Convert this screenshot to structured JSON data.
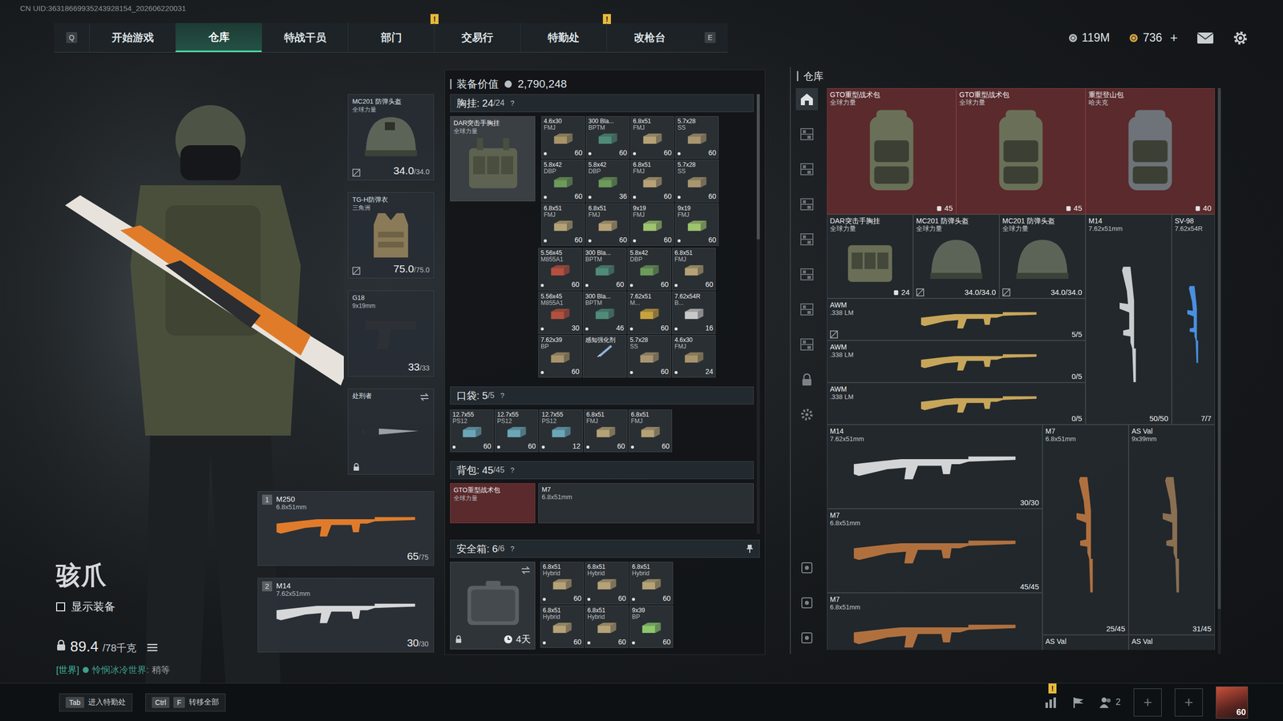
{
  "uid": "CN UID:36318669935243928154_202606220031",
  "nav": {
    "left_key": "Q",
    "right_key": "E",
    "alert_glyph": "!",
    "tabs": [
      {
        "label": "开始游戏",
        "selected": false,
        "alert": false
      },
      {
        "label": "仓库",
        "selected": true,
        "alert": false
      },
      {
        "label": "特战干员",
        "selected": false,
        "alert": false
      },
      {
        "label": "部门",
        "selected": false,
        "alert": true
      },
      {
        "label": "交易行",
        "selected": false,
        "alert": false
      },
      {
        "label": "特勤处",
        "selected": false,
        "alert": true
      },
      {
        "label": "改枪台",
        "selected": false,
        "alert": false
      }
    ]
  },
  "currency": [
    {
      "value": "119M",
      "color": "#b9bec4"
    },
    {
      "value": "736",
      "color": "#d9a441",
      "action": "+"
    }
  ],
  "character": {
    "name": "骇爪",
    "show_gear": {
      "label": "显示装备",
      "checked": false
    },
    "weight": "89.4",
    "weight_max": "/78千克"
  },
  "chat": {
    "channel": "[世界]",
    "sender": "怜悯冰冷世界:",
    "message": "稍等"
  },
  "equipment": [
    {
      "kind": "helmet",
      "name": "MC201 防弹头盔",
      "sub": "全球力量",
      "reading": "34.0",
      "max": "/34.0",
      "mark": true,
      "locked": false
    },
    {
      "kind": "vest",
      "name": "TG-H防弹衣",
      "sub": "三角洲",
      "reading": "75.0",
      "max": "/75.0",
      "mark": true,
      "locked": false
    },
    {
      "kind": "pistol",
      "name": "G18",
      "sub": "9x19mm",
      "reading": "33",
      "max": "/33",
      "mark": false,
      "locked": false
    },
    {
      "kind": "melee",
      "name": "处刑者",
      "mark": false,
      "locked": true
    }
  ],
  "weapons": [
    {
      "slot": "1",
      "name": "M250",
      "caliber": "6.8x51mm",
      "ammo": "65",
      "max": "/75",
      "color": "#e07b2a"
    },
    {
      "slot": "2",
      "name": "M14",
      "caliber": "7.62x51mm",
      "ammo": "30",
      "max": "/30",
      "color": "#d5d7d9"
    }
  ],
  "loadout": {
    "value_label": "装备价值",
    "value": "2,790,248",
    "chest": {
      "label": "胸挂",
      "count": "24",
      "max": "/24",
      "help": "?",
      "rig": {
        "name": "DAR突击手胸挂",
        "sub": "全球力量"
      },
      "blocks": [
        [
          {
            "kind": "ammo",
            "name": "4.6x30",
            "sub": "FMJ",
            "count": "60",
            "color": "#a8946a"
          },
          {
            "kind": "ammo",
            "name": "300 Bla...",
            "sub": "BPTM",
            "count": "60",
            "color": "#4f8b78"
          },
          {
            "kind": "ammo",
            "name": "6.8x51",
            "sub": "FMJ",
            "count": "60",
            "color": "#b5a276"
          },
          {
            "kind": "ammo",
            "name": "5.7x28",
            "sub": "SS",
            "count": "60",
            "color": "#a89670"
          },
          {
            "kind": "ammo",
            "name": "5.8x42",
            "sub": "DBP",
            "count": "60",
            "color": "#6e9a5a"
          },
          {
            "kind": "ammo",
            "name": "5.8x42",
            "sub": "DBP",
            "count": "36",
            "color": "#6e9a5a"
          },
          {
            "kind": "ammo",
            "name": "6.8x51",
            "sub": "FMJ",
            "count": "60",
            "color": "#b5a276"
          },
          {
            "kind": "ammo",
            "name": "5.7x28",
            "sub": "SS",
            "count": "60",
            "color": "#a89670"
          },
          {
            "kind": "ammo",
            "name": "6.8x51",
            "sub": "FMJ",
            "count": "60",
            "color": "#b5a276"
          },
          {
            "kind": "ammo",
            "name": "6.8x51",
            "sub": "FMJ",
            "count": "60",
            "color": "#b5a276"
          },
          {
            "kind": "ammo",
            "name": "9x19",
            "sub": "FMJ",
            "count": "60",
            "color": "#9ec46e"
          },
          {
            "kind": "ammo",
            "name": "9x19",
            "sub": "FMJ",
            "count": "60",
            "color": "#9ec46e"
          }
        ],
        [
          {
            "kind": "ammo",
            "name": "5.56x45",
            "sub": "M855A1",
            "count": "60",
            "color": "#b4503e"
          },
          {
            "kind": "ammo",
            "name": "300 Bla...",
            "sub": "BPTM",
            "count": "60",
            "color": "#4f8b78"
          },
          {
            "kind": "ammo",
            "name": "5.8x42",
            "sub": "DBP",
            "count": "60",
            "color": "#6e9a5a"
          },
          {
            "kind": "ammo",
            "name": "6.8x51",
            "sub": "FMJ",
            "count": "60",
            "color": "#b5a276"
          },
          {
            "kind": "ammo",
            "name": "5.56x45",
            "sub": "M855A1",
            "count": "30",
            "color": "#b4503e"
          },
          {
            "kind": "ammo",
            "name": "300 Bla...",
            "sub": "BPTM",
            "count": "46",
            "color": "#4f8b78"
          },
          {
            "kind": "ammo",
            "name": "7.62x51",
            "sub": "M...",
            "count": "60",
            "color": "#c9a23e"
          },
          {
            "kind": "ammo",
            "name": "7.62x54R",
            "sub": "B...",
            "count": "16",
            "color": "#c9c9c9"
          },
          {
            "kind": "ammo",
            "name": "7.62x39",
            "sub": "BP",
            "count": "60",
            "color": "#a8946a"
          },
          {
            "kind": "item",
            "name": "感知强化剂",
            "color": "#8fb0d8"
          },
          {
            "kind": "ammo",
            "name": "5.7x28",
            "sub": "SS",
            "count": "60",
            "color": "#a89670"
          },
          {
            "kind": "ammo",
            "name": "4.6x30",
            "sub": "FMJ",
            "count": "24",
            "color": "#a8946a"
          }
        ]
      ]
    },
    "pockets": {
      "label": "口袋",
      "count": "5",
      "max": "/5",
      "help": "?",
      "items": [
        {
          "kind": "ammo",
          "name": "12.7x55",
          "sub": "PS12",
          "count": "60",
          "color": "#6aa6b8"
        },
        {
          "kind": "ammo",
          "name": "12.7x55",
          "sub": "PS12",
          "count": "60",
          "color": "#6aa6b8"
        },
        {
          "kind": "ammo",
          "name": "12.7x55",
          "sub": "PS12",
          "count": "12",
          "color": "#6aa6b8"
        },
        {
          "kind": "ammo",
          "name": "6.8x51",
          "sub": "FMJ",
          "count": "60",
          "color": "#b5a276"
        },
        {
          "kind": "ammo",
          "name": "6.8x51",
          "sub": "FMJ",
          "count": "60",
          "color": "#b5a276"
        }
      ]
    },
    "backpack": {
      "label": "背包",
      "count": "45",
      "max": "/45",
      "help": "?",
      "bag": {
        "name": "GTO重型战术包",
        "sub": "全球力量"
      },
      "items": [
        {
          "name": "M7",
          "sub": "6.8x51mm"
        }
      ]
    },
    "safe": {
      "label": "安全箱",
      "count": "6",
      "max": "/6",
      "help": "?",
      "timer": "4天",
      "items": [
        {
          "kind": "ammo",
          "name": "6.8x51",
          "sub": "Hybrid",
          "count": "60",
          "color": "#b5a276"
        },
        {
          "kind": "ammo",
          "name": "6.8x51",
          "sub": "Hybrid",
          "count": "60",
          "color": "#b5a276"
        },
        {
          "kind": "ammo",
          "name": "6.8x51",
          "sub": "Hybrid",
          "count": "60",
          "color": "#b5a276"
        },
        {
          "kind": "ammo",
          "name": "6.8x51",
          "sub": "Hybrid",
          "count": "60",
          "color": "#b5a276"
        },
        {
          "kind": "ammo",
          "name": "6.8x51",
          "sub": "Hybrid",
          "count": "60",
          "color": "#b5a276"
        },
        {
          "kind": "ammo",
          "name": "9x39",
          "sub": "BP",
          "count": "60",
          "color": "#8cc86a"
        }
      ]
    }
  },
  "warehouse": {
    "title": "仓库",
    "sidebar": [
      {
        "selected": true
      },
      {
        "selected": false
      },
      {
        "selected": false
      },
      {
        "selected": false
      },
      {
        "selected": false
      },
      {
        "selected": false
      },
      {
        "selected": false
      },
      {
        "selected": false
      },
      {
        "selected": false
      },
      {
        "selected": false
      },
      {
        "selected": false
      },
      {
        "selected": false
      },
      {
        "selected": false
      }
    ],
    "items": [
      {
        "kind": "bag",
        "name": "GTO重型战术包",
        "sub": "全球力量",
        "reading": "45",
        "highlight": true,
        "mark": false,
        "color": "#6a7058"
      },
      {
        "kind": "bag",
        "name": "GTO重型战术包",
        "sub": "全球力量",
        "reading": "45",
        "highlight": true,
        "mark": false,
        "color": "#6a7058"
      },
      {
        "kind": "bag",
        "name": "重型登山包",
        "sub": "哈夫克",
        "reading": "40",
        "highlight": true,
        "mark": false,
        "color": "#6d7378"
      },
      {
        "kind": "rig",
        "name": "DAR突击手胸挂",
        "sub": "全球力量",
        "reading": "24",
        "highlight": false,
        "mark": false,
        "color": "#6a6e56"
      },
      {
        "kind": "helmet",
        "name": "MC201 防弹头盔",
        "sub": "全球力量",
        "reading": "34.0/34.0",
        "highlight": false,
        "mark": true,
        "color": "#5c6458"
      },
      {
        "kind": "helmet",
        "name": "MC201 防弹头盔",
        "sub": "全球力量",
        "reading": "34.0/34.0",
        "highlight": false,
        "mark": true,
        "color": "#5c6458"
      },
      {
        "kind": "rifle-tall",
        "name": "M14",
        "sub": "7.62x51mm",
        "reading": "50/50",
        "highlight": false,
        "mark": false,
        "color": "#c9ccce"
      },
      {
        "kind": "rifle-thin",
        "name": "SV-98",
        "sub": "7.62x54R",
        "reading": "7/7",
        "highlight": false,
        "mark": false,
        "color": "#4a8fe0"
      },
      {
        "kind": "rifle-long",
        "name": "AWM",
        "sub": ".338 LM",
        "reading": "5/5",
        "highlight": false,
        "mark": true,
        "color": "#c7a65a"
      },
      {
        "kind": "rifle-long",
        "name": "AWM",
        "sub": ".338 LM",
        "reading": "0/5",
        "highlight": false,
        "mark": false,
        "color": "#c7a65a"
      },
      {
        "kind": "rifle-long",
        "name": "AWM",
        "sub": ".338 LM",
        "reading": "0/5",
        "highlight": false,
        "mark": false,
        "color": "#c7a65a"
      },
      {
        "kind": "rifle",
        "name": "M14",
        "sub": "7.62x51mm",
        "reading": "30/30",
        "highlight": false,
        "mark": false,
        "color": "#d2d4d6"
      },
      {
        "kind": "rifle-tall",
        "name": "M7",
        "sub": "6.8x51mm",
        "reading": "25/45",
        "highlight": false,
        "mark": false,
        "color": "#b0703e"
      },
      {
        "kind": "rifle-tall",
        "name": "AS Val",
        "sub": "9x39mm",
        "reading": "31/45",
        "highlight": false,
        "mark": false,
        "color": "#8a7050"
      },
      {
        "kind": "rifle",
        "name": "M7",
        "sub": "6.8x51mm",
        "reading": "45/45",
        "highlight": false,
        "mark": false,
        "color": "#b0703e"
      },
      {
        "kind": "rifle",
        "name": "M7",
        "sub": "6.8x51mm",
        "highlight": false,
        "mark": false,
        "color": "#b0703e"
      },
      {
        "kind": "rifle-tall",
        "name": "AS Val",
        "highlight": false,
        "mark": false,
        "color": "#8a7050"
      },
      {
        "kind": "rifle-tall",
        "name": "AS Val",
        "highlight": false,
        "mark": false,
        "color": "#8a7050"
      }
    ]
  },
  "hints": [
    {
      "keys": [
        "Tab"
      ],
      "label": "进入特勤处"
    },
    {
      "keys": [
        "Ctrl",
        "F"
      ],
      "label": "转移全部"
    }
  ],
  "social": {
    "alert_glyph": "!",
    "buttons": [
      {
        "kind": "stats",
        "alert": true
      },
      {
        "kind": "flag",
        "alert": false
      },
      {
        "kind": "friends",
        "alert": false,
        "count": "2"
      }
    ],
    "slots": [
      "+",
      "+"
    ],
    "avatar_level": "60"
  }
}
